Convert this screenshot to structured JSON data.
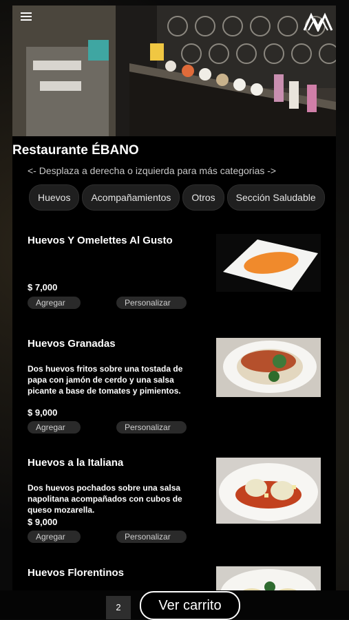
{
  "header": {
    "restaurant_title": "Restaurante ÉBANO",
    "scroll_hint": "<- Desplaza a derecha o izquierda para más categorias ->"
  },
  "categories": [
    "Huevos",
    "Acompañamientos",
    "Otros",
    "Sección Saludable"
  ],
  "items": [
    {
      "name": "Huevos Y Omelettes Al Gusto",
      "description": "",
      "price": "$ 7,000",
      "add_label": "Agregar",
      "customize_label": "Personalizar"
    },
    {
      "name": "Huevos Granadas",
      "description": "Dos huevos fritos sobre una tostada de papa con jamón de cerdo y una salsa picante a base de tomates y pimientos.",
      "price": "$ 9,000",
      "add_label": "Agregar",
      "customize_label": "Personalizar"
    },
    {
      "name": "Huevos a la Italiana",
      "description": "Dos huevos pochados sobre una salsa napolitana acompañados con cubos de queso mozarella.",
      "price": "$ 9,000",
      "add_label": "Agregar",
      "customize_label": "Personalizar"
    },
    {
      "name": "Huevos Florentinos",
      "description": "",
      "price": "",
      "add_label": "",
      "customize_label": ""
    }
  ],
  "footer": {
    "cart_count": "2",
    "cart_button_label": "Ver carrito"
  },
  "icons": {
    "menu": "hamburger-menu-icon",
    "logo": "brand-logo-icon"
  },
  "colors": {
    "background": "#000000",
    "pill": "#2a2a2a",
    "text": "#ffffff"
  }
}
